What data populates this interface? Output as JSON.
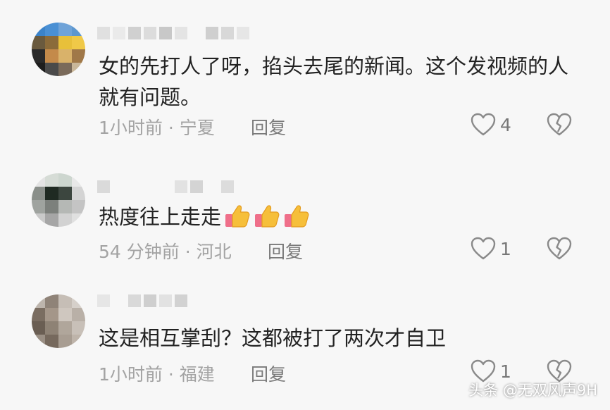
{
  "colors": {
    "background": "#f7f7f7",
    "text": "#222222",
    "meta": "#a3a3a3",
    "reply": "#7a7a7a",
    "icon": "#8a8a8a"
  },
  "comments": [
    {
      "text": "女的先打人了呀，掐头去尾的新闻。这个发视频的人就有问题。",
      "meta": "1小时前 · 宁夏",
      "reply_label": "回复",
      "like_count": "4",
      "emoji": []
    },
    {
      "text": "热度往上走走",
      "meta": "54 分钟前 · 河北",
      "reply_label": "回复",
      "like_count": "1",
      "emoji": [
        "thumbs-up",
        "thumbs-up",
        "thumbs-up"
      ]
    },
    {
      "text": "这是相互掌刮？这都被打了两次才自卫",
      "meta": "1小时前 · 福建",
      "reply_label": "回复",
      "like_count": "1",
      "emoji": []
    }
  ],
  "watermark": "头条 @无双风声9H"
}
